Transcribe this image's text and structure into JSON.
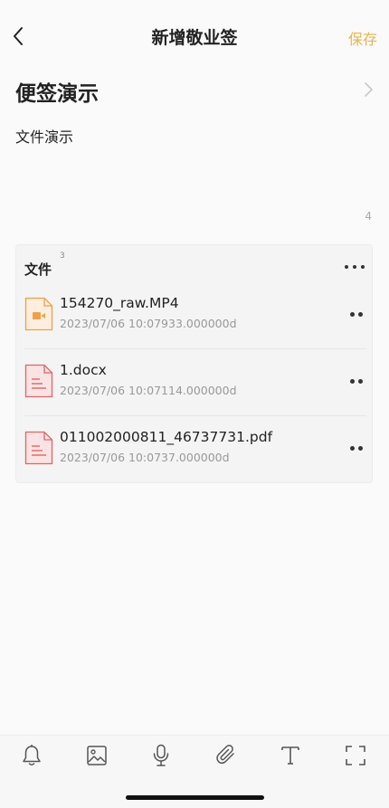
{
  "header": {
    "title": "新增敬业签",
    "save_label": "保存"
  },
  "note": {
    "title": "便签演示",
    "body": "文件演示",
    "char_count": "4"
  },
  "files": {
    "label": "文件",
    "count": "3",
    "items": [
      {
        "name": "154270_raw.MP4",
        "meta": "2023/07/06 10:07933.000000d",
        "type": "video-file-icon"
      },
      {
        "name": "1.docx",
        "meta": "2023/07/06 10:07114.000000d",
        "type": "document-file-icon"
      },
      {
        "name": "011002000811_46737731.pdf",
        "meta": "2023/07/06 10:0737.000000d",
        "type": "document-file-icon"
      }
    ]
  },
  "toolbar": {
    "tools": [
      "bell-icon",
      "image-icon",
      "microphone-icon",
      "paperclip-icon",
      "text-format-icon",
      "fullscreen-icon"
    ]
  },
  "colors": {
    "accent": "#e8b54a",
    "video_icon": "#f0a04b",
    "doc_icon": "#e06565"
  }
}
